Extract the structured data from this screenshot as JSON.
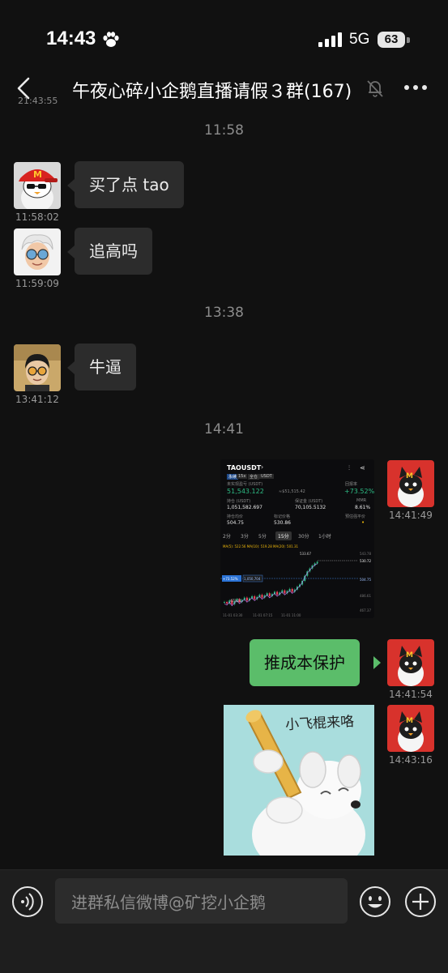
{
  "status_bar": {
    "time": "14:43",
    "network": "5G",
    "battery": "63"
  },
  "header": {
    "title": "午夜心碎小企鹅直播请假３群(167)",
    "cut_timestamp": "21:43:55"
  },
  "messages": [
    {
      "type": "separator",
      "text": "11:58"
    },
    {
      "type": "text",
      "side": "left",
      "avatar": "mcdonalds-penguin-avatar",
      "text": "买了点 tao",
      "time": "11:58:02"
    },
    {
      "type": "text",
      "side": "left",
      "avatar": "memoji-avatar",
      "text": "追高吗",
      "time": "11:59:09"
    },
    {
      "type": "separator",
      "text": "13:38"
    },
    {
      "type": "text",
      "side": "left",
      "avatar": "glasses-boy-avatar",
      "text": "牛逼",
      "time": "13:41:12"
    },
    {
      "type": "separator",
      "text": "14:41"
    },
    {
      "type": "image",
      "side": "right",
      "avatar": "red-penguin-avatar",
      "time": "14:41:49",
      "screenshot": {
        "pair": "TAOUSDT",
        "tags": [
          "永续",
          "15x",
          "全仓",
          "USDT"
        ],
        "pnl_label": "未实现盈亏 (USDT)",
        "pnl": "51,543.122",
        "pnl_sub": "≈$51,515.42",
        "roe_label": "回报率",
        "roe": "+73.52%",
        "size_label": "持仓 (USDT)",
        "size": "1,051,582.697",
        "margin_label": "保证金 (USDT)",
        "margin": "70,105.5132",
        "mmr_label": "MMR",
        "mmr": "8.61%",
        "entry_label": "持仓均价",
        "entry": "504.75",
        "mark_label": "标记价格",
        "mark": "530.86",
        "liq_label": "预估强平价",
        "intervals": [
          "2分",
          "3分",
          "5分",
          "15分",
          "30分",
          "1小时"
        ],
        "ma_line": "MA(5): 522.56  MA(10): 519.28  MA(20): 501.31",
        "price_labels": [
          "543.78",
          "533.67",
          "530.72",
          "504.75",
          "486.61",
          "467.37",
          "473.21"
        ],
        "position_tag": "+73.52%",
        "position_val": "1,050,704",
        "time_labels": [
          "11-01 03:30",
          "11-01 07:15",
          "11-01 11:00"
        ],
        "close_prices": [
          476,
          474,
          478,
          473,
          477,
          480,
          476,
          479,
          482,
          478,
          481,
          484,
          480,
          483,
          486,
          482,
          485,
          488,
          484,
          487,
          490,
          486,
          489,
          492,
          488,
          491,
          494,
          490,
          493,
          497,
          500,
          505,
          512,
          518,
          522,
          526,
          529,
          531
        ]
      }
    },
    {
      "type": "text",
      "side": "right",
      "avatar": "red-penguin-avatar",
      "text": "推成本保护",
      "time": "14:41:54"
    },
    {
      "type": "sticker",
      "side": "right",
      "avatar": "red-penguin-avatar",
      "time": "14:43:16",
      "sticker_text": "小飞棍来咯"
    }
  ],
  "input": {
    "placeholder": "进群私信微博@矿挖小企鹅"
  },
  "icons": [
    "paw-icon",
    "signal-icon",
    "back-icon",
    "mute-bell-icon",
    "more-icon",
    "voice-icon",
    "emoji-icon",
    "plus-icon"
  ],
  "colors": {
    "background": "#111111",
    "bubble_left": "#2c2c2c",
    "bubble_right": "#5bbd6a",
    "profit": "#2ebd85",
    "loss": "#f6465d"
  }
}
